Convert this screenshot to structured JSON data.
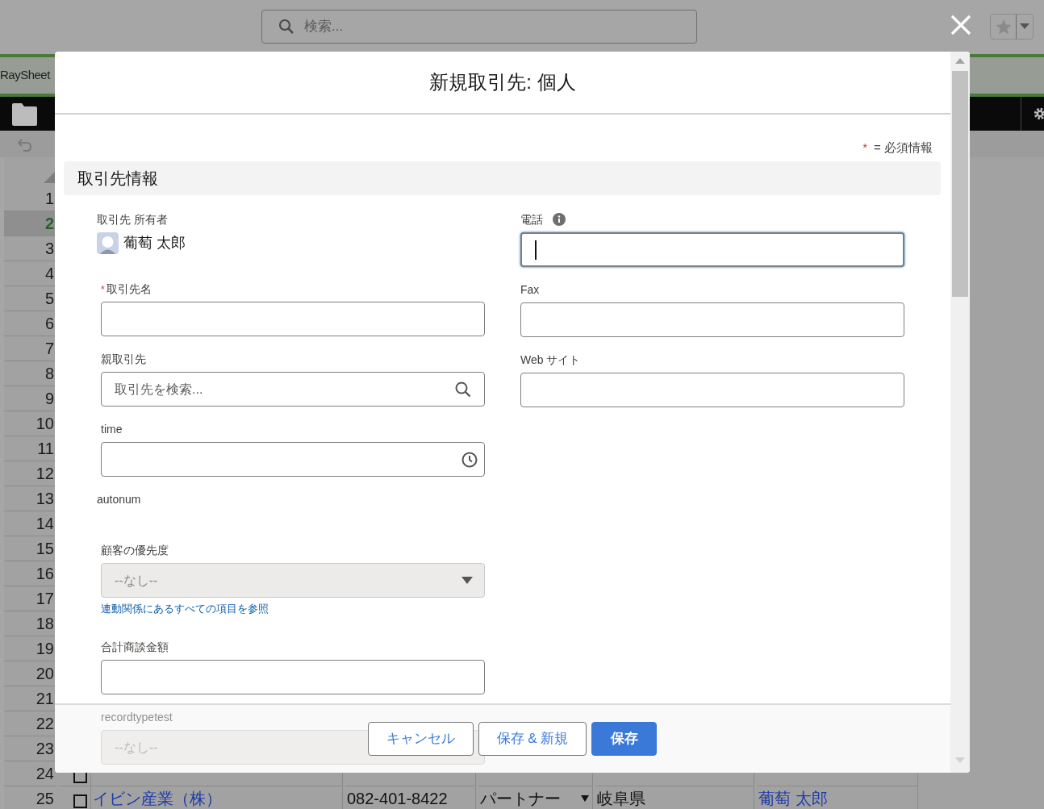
{
  "background": {
    "search_placeholder": "検索...",
    "app_tab": "RaySheet",
    "row_numbers": [
      {
        "label": "1",
        "selected": false
      },
      {
        "label": "2",
        "selected": true
      },
      {
        "label": "3",
        "selected": false
      },
      {
        "label": "4",
        "selected": false
      },
      {
        "label": "5",
        "selected": false
      },
      {
        "label": "6",
        "selected": false
      },
      {
        "label": "7",
        "selected": false
      },
      {
        "label": "8",
        "selected": false
      },
      {
        "label": "9",
        "selected": false
      },
      {
        "label": "10",
        "selected": false
      },
      {
        "label": "11",
        "selected": false
      },
      {
        "label": "12",
        "selected": false
      },
      {
        "label": "13",
        "selected": false
      },
      {
        "label": "14",
        "selected": false
      },
      {
        "label": "15",
        "selected": false
      },
      {
        "label": "16",
        "selected": false
      },
      {
        "label": "17",
        "selected": false
      },
      {
        "label": "18",
        "selected": false
      },
      {
        "label": "19",
        "selected": false
      },
      {
        "label": "20",
        "selected": false
      },
      {
        "label": "21",
        "selected": false
      },
      {
        "label": "22",
        "selected": false
      },
      {
        "label": "23",
        "selected": false
      },
      {
        "label": "24",
        "selected": false
      },
      {
        "label": "25",
        "selected": false
      }
    ],
    "table_rows": [
      {
        "checked": false
      },
      {
        "checked": false,
        "name": "イビン産業（株）",
        "phone": "082-401-8422",
        "type": "パートナー",
        "prefecture": "岐阜県",
        "owner": "葡萄 太郎"
      }
    ]
  },
  "modal": {
    "title": "新規取引先: 個人",
    "required_mark": "*",
    "required_legend": "= 必須情報",
    "section": "取引先情報",
    "left_fields": [
      {
        "kind": "owner",
        "label": "取引先 所有者",
        "value": "葡萄 太郎"
      },
      {
        "kind": "text",
        "label": "取引先名",
        "required": true
      },
      {
        "kind": "lookup",
        "label": "親取引先",
        "placeholder": "取引先を検索..."
      },
      {
        "kind": "time",
        "label": "time"
      },
      {
        "kind": "readonly",
        "label": "autonum"
      },
      {
        "kind": "picklist",
        "label": "顧客の優先度",
        "value": "--なし--",
        "link": "連動関係にあるすべての項目を参照"
      },
      {
        "kind": "text",
        "label": "合計商談金額",
        "required": false
      },
      {
        "kind": "picklist",
        "label": "recordtypetest",
        "value": "--なし--"
      }
    ],
    "right_fields": [
      {
        "kind": "text",
        "label": "電話",
        "info": true,
        "focused": true,
        "required": false
      },
      {
        "kind": "text",
        "label": "Fax",
        "focused": false,
        "required": false
      },
      {
        "kind": "text",
        "label": "Web サイト",
        "focused": false,
        "required": false
      }
    ],
    "buttons": [
      {
        "label": "キャンセル",
        "kind": "neutral"
      },
      {
        "label": "保存 & 新規",
        "kind": "neutral"
      },
      {
        "label": "保存",
        "kind": "brand"
      }
    ]
  }
}
